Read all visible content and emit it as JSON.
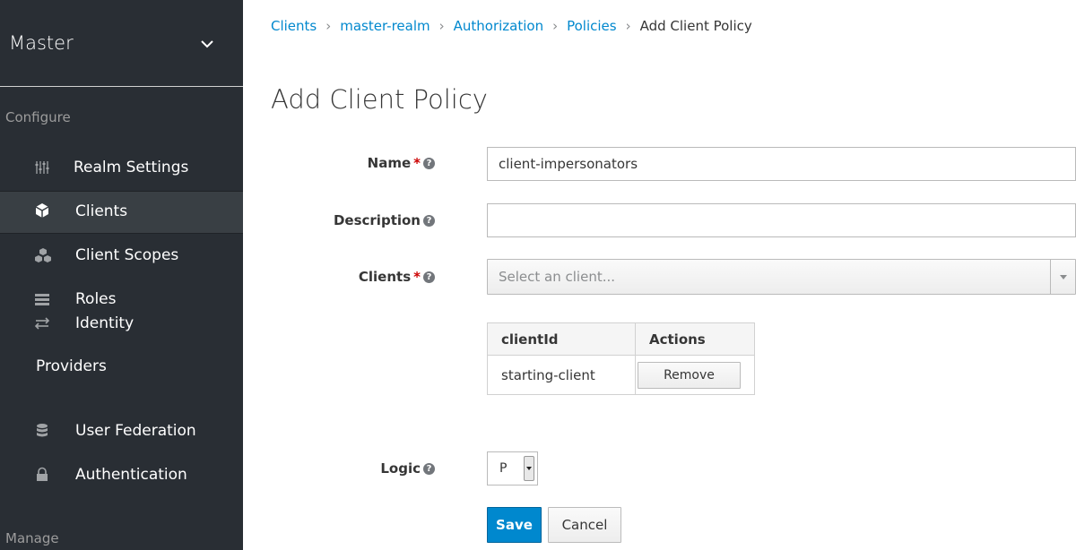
{
  "sidebar": {
    "realm": "Master",
    "configure_label": "Configure",
    "manage_label": "Manage",
    "items": [
      {
        "label": "Realm Settings",
        "icon": "sliders-icon"
      },
      {
        "label": "Clients",
        "icon": "cube-icon",
        "active": true
      },
      {
        "label": "Client Scopes",
        "icon": "cubes-icon"
      },
      {
        "label": "Roles",
        "icon": "list-icon"
      },
      {
        "label": "Identity",
        "icon": "exchange-icon"
      },
      {
        "label": "Providers"
      },
      {
        "label": "User Federation",
        "icon": "database-icon"
      },
      {
        "label": "Authentication",
        "icon": "lock-icon"
      }
    ]
  },
  "breadcrumb": {
    "items": [
      "Clients",
      "master-realm",
      "Authorization",
      "Policies"
    ],
    "current": "Add Client Policy",
    "separator": "›"
  },
  "page": {
    "title": "Add Client Policy"
  },
  "form": {
    "name_label": "Name",
    "name_value": "client-impersonators",
    "description_label": "Description",
    "description_value": "",
    "clients_label": "Clients",
    "clients_placeholder": "Select an client...",
    "required_mark": "*",
    "help_glyph": "?",
    "table": {
      "headers": [
        "clientId",
        "Actions"
      ],
      "rows": [
        {
          "clientId": "starting-client",
          "action": "Remove"
        }
      ]
    },
    "logic_label": "Logic",
    "logic_value": "P",
    "save_label": "Save",
    "cancel_label": "Cancel"
  },
  "colors": {
    "sidebar_bg": "#292e34",
    "accent": "#0088ce",
    "required": "#cc0000"
  }
}
